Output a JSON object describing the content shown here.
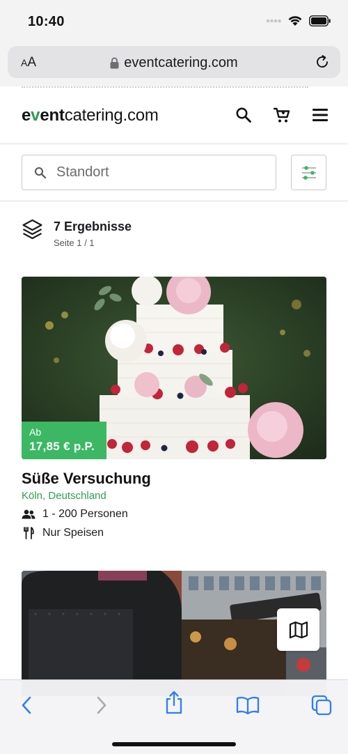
{
  "status_bar": {
    "time": "10:40"
  },
  "browser": {
    "text_size_label": {
      "small": "A",
      "large": "A"
    },
    "url": "eventcatering.com"
  },
  "site": {
    "logo": {
      "part1": "e",
      "part2": "v",
      "part3": "ent",
      "part4": "catering.com"
    }
  },
  "search": {
    "placeholder": "Standort",
    "value": ""
  },
  "results": {
    "count_label": "7 Ergebnisse",
    "page_label": "Seite 1 / 1"
  },
  "listings": [
    {
      "price_prefix": "Ab",
      "price": "17,85 € p.P.",
      "title": "Süße Versuchung",
      "location": "Köln, Deutschland",
      "guests": "1 - 200 Personen",
      "service": "Nur Speisen"
    }
  ],
  "colors": {
    "brand_green": "#3cb864",
    "link_green": "#2e9e4f",
    "ios_blue": "#2f7cf6"
  },
  "icons": [
    "wifi-icon",
    "battery-icon",
    "lock-icon",
    "reload-icon",
    "search-icon",
    "cart-icon",
    "menu-icon",
    "filter-icon",
    "layers-icon",
    "people-icon",
    "cutlery-icon",
    "map-icon",
    "back-icon",
    "forward-icon",
    "share-icon",
    "bookmarks-icon",
    "tabs-icon"
  ]
}
